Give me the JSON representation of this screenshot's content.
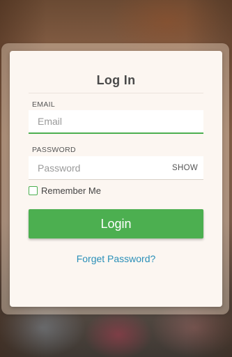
{
  "login_card": {
    "title": "Log In",
    "email": {
      "label": "EMAIL",
      "placeholder": "Email",
      "value": ""
    },
    "password": {
      "label": "PASSWORD",
      "placeholder": "Password",
      "value": "",
      "show_label": "SHOW"
    },
    "remember": {
      "label": "Remember Me",
      "checked": false
    },
    "login_button": "Login",
    "forgot_link": "Forget Password?"
  },
  "colors": {
    "accent": "#4caf50",
    "link": "#2a8fb8",
    "card_background": "#fcf6f1"
  }
}
